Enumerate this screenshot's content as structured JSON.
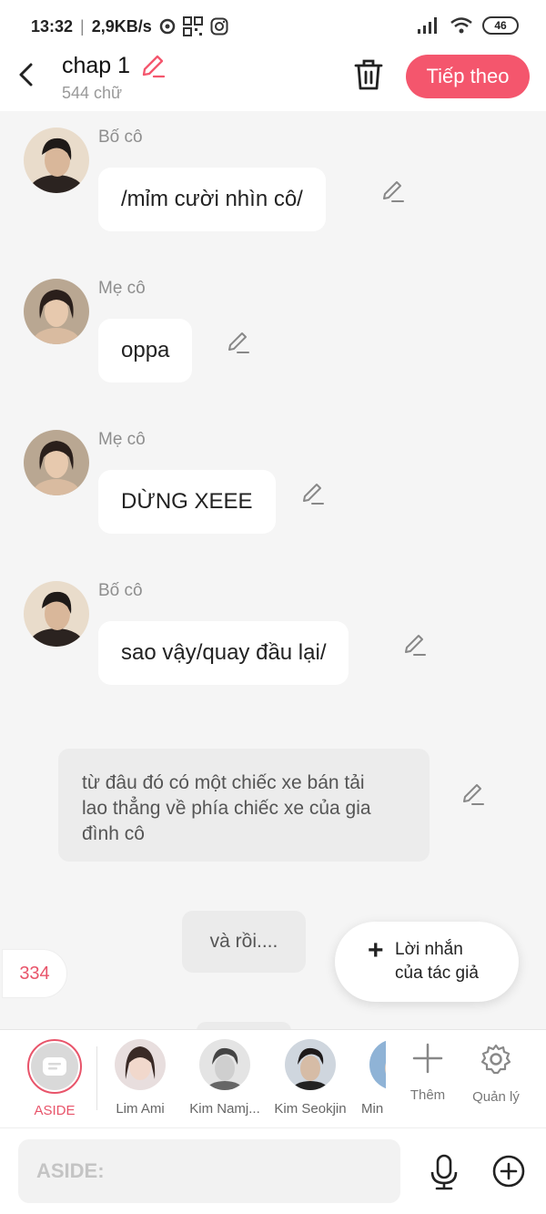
{
  "status": {
    "time": "13:32",
    "speed": "2,9KB/s",
    "battery": "46"
  },
  "header": {
    "title": "chap 1",
    "word_count": "544 chữ",
    "next_label": "Tiếp theo"
  },
  "messages": [
    {
      "sender": "Bố cô",
      "text": "/mỉm cười nhìn cô/"
    },
    {
      "sender": "Mẹ cô",
      "text": "oppa"
    },
    {
      "sender": "Mẹ cô",
      "text": "DỪNG XEEE"
    },
    {
      "sender": "Bố cô",
      "text": "sao vậy/quay đầu lại/"
    }
  ],
  "narration": {
    "lines": [
      "từ đâu đó có một chiếc xe bán tải",
      "lao thẳng về phía chiếc xe của gia",
      "đình cô"
    ]
  },
  "small_bubble": "và rồi....",
  "count_badge": "334",
  "author_note": {
    "line1": "Lời nhắn",
    "line2": "của tác giả"
  },
  "characters": [
    {
      "name": "ASIDE",
      "selected": true
    },
    {
      "name": "Lim Ami"
    },
    {
      "name": "Kim Namj..."
    },
    {
      "name": "Kim Seokjin"
    },
    {
      "name": "Min"
    }
  ],
  "tools": {
    "add_label": "Thêm",
    "manage_label": "Quản lý"
  },
  "input": {
    "placeholder": "ASIDE:"
  },
  "colors": {
    "accent": "#f4566d",
    "badge_text": "#e8546a"
  }
}
